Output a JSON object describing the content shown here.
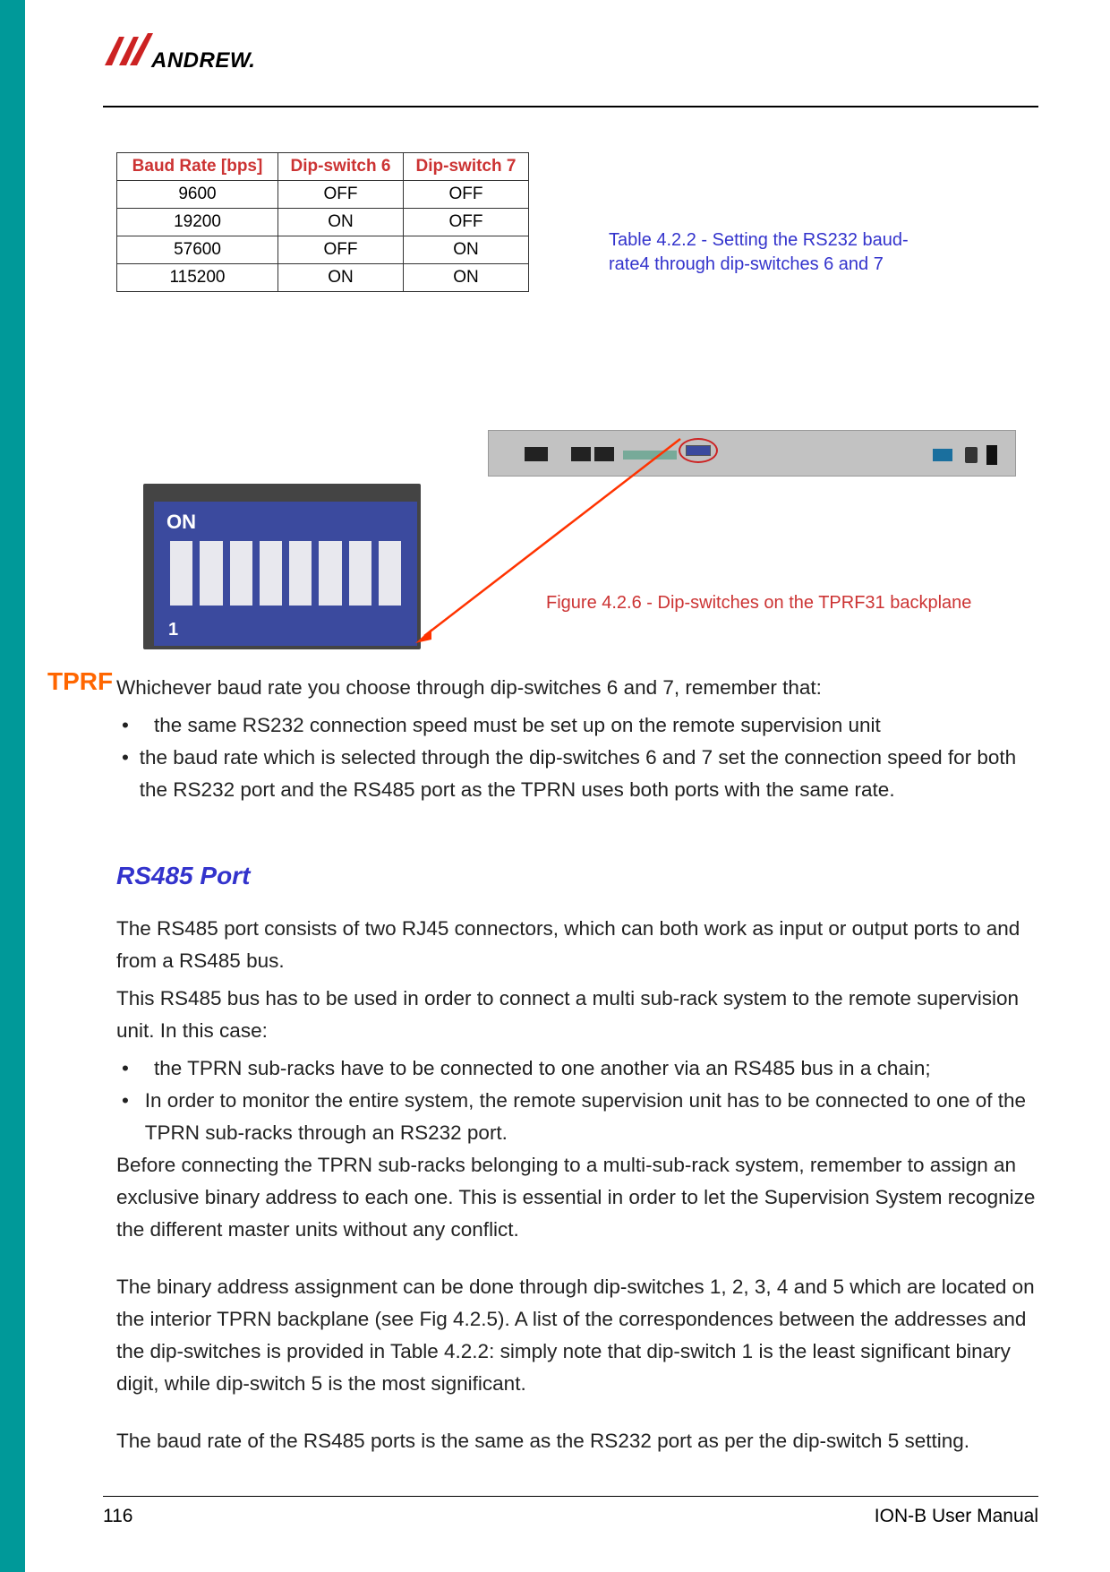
{
  "logo": {
    "text": "ANDREW."
  },
  "sidebar_label": "TPRF",
  "table": {
    "headers": [
      "Baud Rate [bps]",
      "Dip-switch 6",
      "Dip-switch 7"
    ],
    "rows": [
      [
        "9600",
        "OFF",
        "OFF"
      ],
      [
        "19200",
        "ON",
        "OFF"
      ],
      [
        "57600",
        "OFF",
        "ON"
      ],
      [
        "115200",
        "ON",
        "ON"
      ]
    ],
    "caption": "Table 4.2.2 - Setting the RS232 baud-rate4 through dip-switches 6 and 7"
  },
  "dip_switch": {
    "on_label": "ON",
    "one_label": "1"
  },
  "figure_caption": "Figure 4.2.6 - Dip-switches on the TPRF31 backplane",
  "body": {
    "intro": "Whichever baud rate you choose through dip-switches 6 and 7, remember that:",
    "b1": "the same RS232 connection speed must be set up on the remote supervision unit",
    "b2": "the baud rate which is selected through the dip-switches 6 and 7 set the connection speed for both the RS232 port and the RS485 port as the TPRN uses both ports with the same rate.",
    "heading": "RS485 Port",
    "p1": "The RS485 port consists of two RJ45 connectors, which can both work as input or output ports to and from a RS485 bus.",
    "p2": "This RS485 bus has to be used in order to connect a multi sub-rack system to the remote supervision unit. In this case:",
    "b3": "the TPRN sub-racks have to be connected to one another via an RS485 bus in a chain;",
    "b4": "In order to monitor the entire system, the remote supervision unit has to be connected to one of the TPRN sub-racks through an RS232 port.",
    "p3": "Before connecting the TPRN sub-racks belonging to a multi-sub-rack system, remember to assign an exclusive binary address to each one. This is essential in order to let the Supervision System recognize the different master units without any conflict.",
    "p4": "The binary address assignment can be done through dip-switches 1, 2, 3, 4 and 5 which are located on the interior TPRN backplane (see Fig 4.2.5). A list of the correspondences between the addresses and the dip-switches is provided in Table 4.2.2: simply note that dip-switch 1 is the least significant binary digit, while dip-switch 5 is the most significant.",
    "p5": "The baud rate of the RS485 ports is the same as the RS232 port as per the dip-switch 5 setting."
  },
  "footer": {
    "page": "116",
    "title": "ION-B User Manual"
  }
}
